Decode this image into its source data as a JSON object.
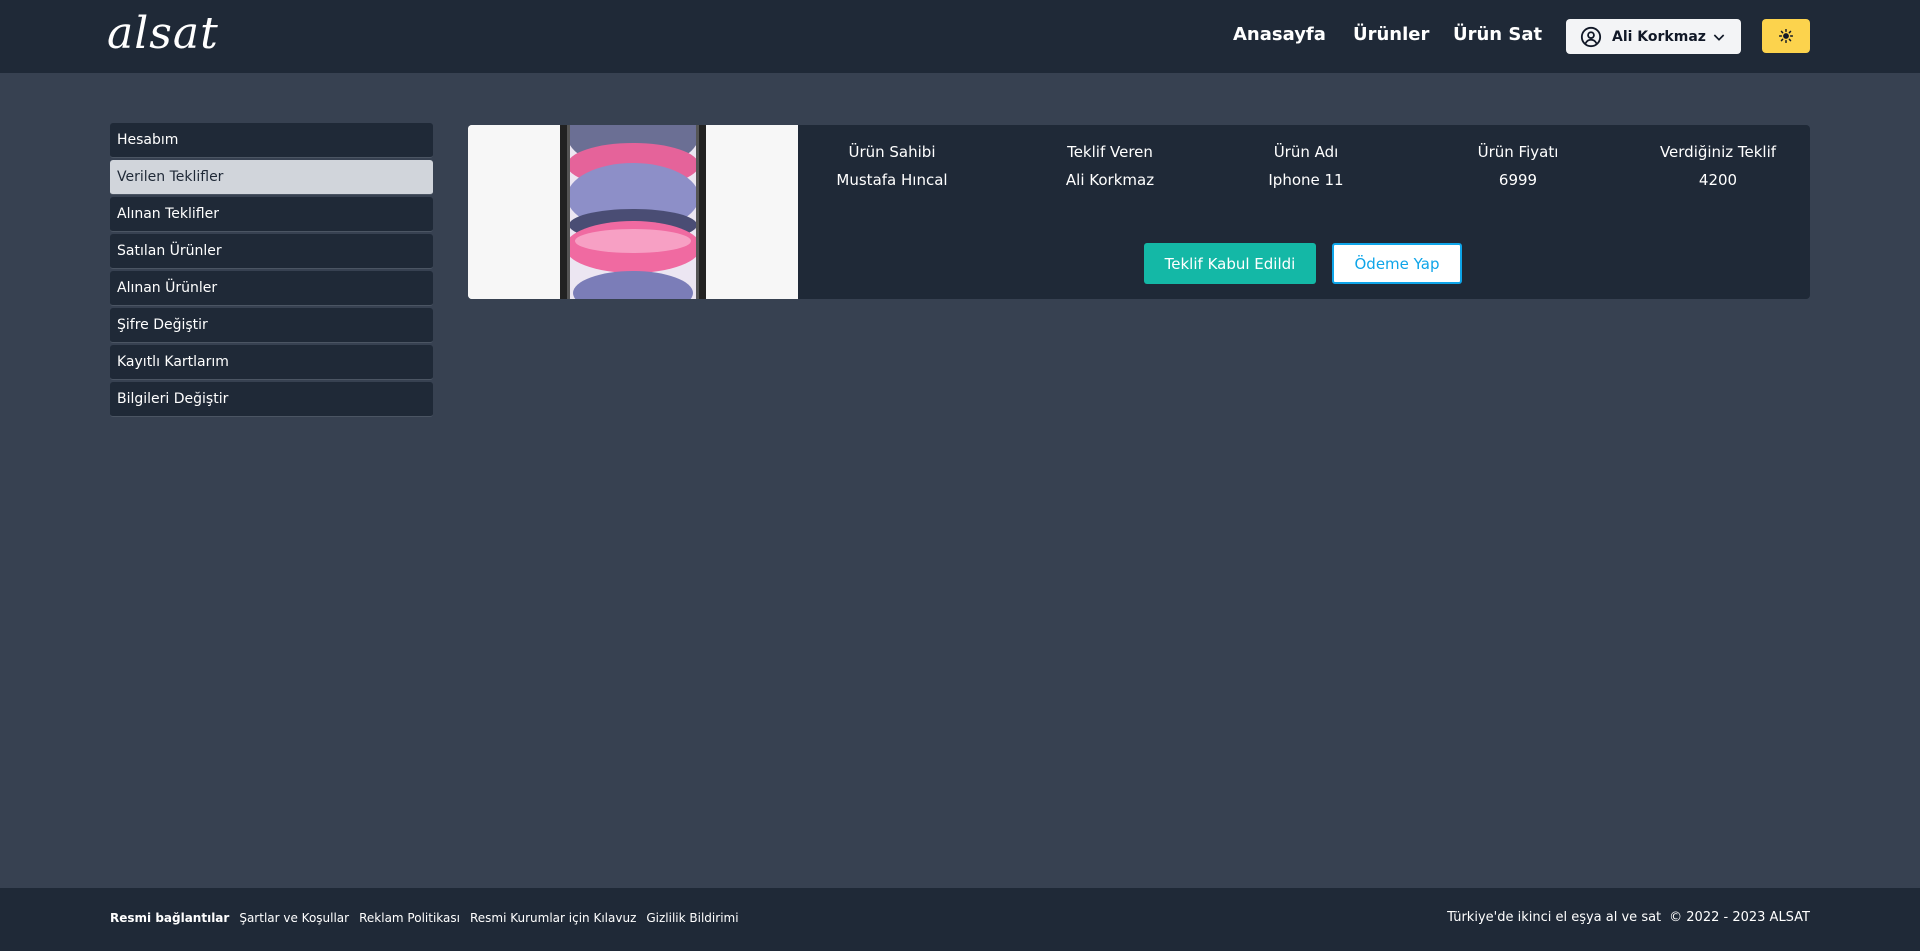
{
  "header": {
    "logo": "alsat",
    "nav": {
      "home": "Anasayfa",
      "products": "Ürünler",
      "sell": "Ürün Sat"
    },
    "user": {
      "name": "Ali Korkmaz"
    },
    "theme_icon": "sun-icon"
  },
  "sidebar": {
    "items": [
      {
        "label": "Hesabım",
        "active": false
      },
      {
        "label": "Verilen Teklifler",
        "active": true
      },
      {
        "label": "Alınan Teklifler",
        "active": false
      },
      {
        "label": "Satılan Ürünler",
        "active": false
      },
      {
        "label": "Alınan Ürünler",
        "active": false
      },
      {
        "label": "Şifre Değiştir",
        "active": false
      },
      {
        "label": "Kayıtlı Kartlarım",
        "active": false
      },
      {
        "label": "Bilgileri Değiştir",
        "active": false
      }
    ]
  },
  "offer": {
    "image": "iphone-11-product-image",
    "headers": {
      "owner": "Ürün Sahibi",
      "bidder": "Teklif Veren",
      "product": "Ürün Adı",
      "price": "Ürün Fiyatı",
      "your_offer": "Verdiğiniz Teklif"
    },
    "values": {
      "owner": "Mustafa Hıncal",
      "bidder": "Ali Korkmaz",
      "product": "Iphone 11",
      "price": "6999",
      "your_offer": "4200"
    },
    "accepted_label": "Teklif Kabul Edildi",
    "pay_label": "Ödeme Yap"
  },
  "footer": {
    "links_title": "Resmi bağlantılar",
    "links": [
      "Şartlar ve Koşullar",
      "Reklam Politikası",
      "Resmi Kurumlar için Kılavuz",
      "Gizlilik Bildirimi"
    ],
    "tagline": "Türkiye'de ikinci el eşya al ve sat",
    "copyright": "© 2022 - 2023 ALSAT"
  },
  "colors": {
    "page_bg": "#374151",
    "panel_bg": "#1f2937",
    "accent_teal": "#14b8a6",
    "accent_blue": "#0ea5e9",
    "theme_yellow": "#fcd34d"
  }
}
